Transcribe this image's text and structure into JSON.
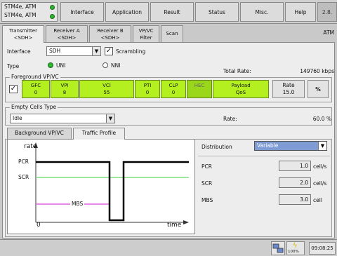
{
  "ports": [
    "STM4e, ATM",
    "STM4e, ATM"
  ],
  "top_tabs": [
    "Interface",
    "Application",
    "Result",
    "Status",
    "Misc.",
    "Help",
    "2.8."
  ],
  "sub_tabs": [
    {
      "line1": "Transmitter",
      "line2": "<SDH>"
    },
    {
      "line1": "Receiver A",
      "line2": "<SDH>"
    },
    {
      "line1": "Receiver B",
      "line2": "<SDH>"
    },
    {
      "line1": "VP/VC",
      "line2": "Filter"
    },
    {
      "line1": "Scan",
      "line2": ""
    }
  ],
  "mode": "ATM",
  "interface": {
    "label": "Interface",
    "value": "SDH",
    "scrambling_label": "Scrambling",
    "scrambling_checked": true
  },
  "type": {
    "label": "Type",
    "options": [
      "UNI",
      "NNI"
    ],
    "selected": "UNI"
  },
  "total_rate": {
    "label": "Total Rate:",
    "value": "149760 kbps"
  },
  "foreground": {
    "title": "Foreground VP/VC",
    "checked": true,
    "fields": [
      {
        "name": "GFC",
        "value": "0"
      },
      {
        "name": "VPI",
        "value": "8"
      },
      {
        "name": "VCI",
        "value": "55"
      },
      {
        "name": "PTI",
        "value": "0"
      },
      {
        "name": "CLP",
        "value": "0"
      },
      {
        "name": "HEC",
        "value": ""
      },
      {
        "name": "Payload",
        "value": "QoS"
      }
    ],
    "rate_label": "Rate",
    "rate_value": "15.0",
    "unit_button": "%"
  },
  "empty_cells": {
    "title": "Empty Cells Type",
    "value": "Idle",
    "rate_label": "Rate:",
    "rate_value": "60.0 %"
  },
  "bottom_tabs": [
    "Background VP/VC",
    "Traffic Profile"
  ],
  "graph": {
    "y_label": "rate",
    "x_label": "time",
    "origin": "0",
    "pcr": "PCR",
    "scr": "SCR",
    "mbs": "MBS"
  },
  "distribution": {
    "label": "Distribution",
    "value": "Variable"
  },
  "params": [
    {
      "label": "PCR",
      "value": "1.0",
      "unit": "cell/s"
    },
    {
      "label": "SCR",
      "value": "2.0",
      "unit": "cell/s"
    },
    {
      "label": "MBS",
      "value": "3.0",
      "unit": "cell"
    }
  ],
  "status": {
    "battery": "100%",
    "time": "09:08:25"
  }
}
